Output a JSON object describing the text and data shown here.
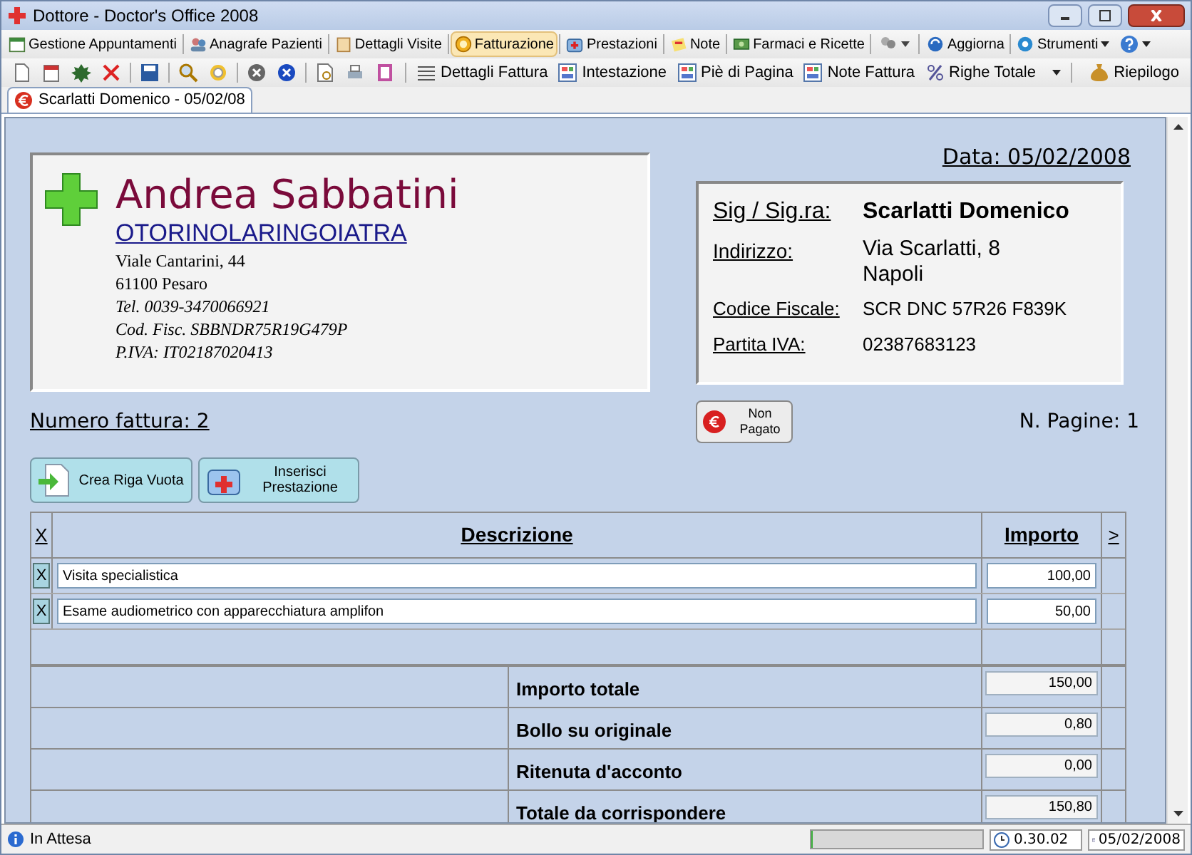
{
  "window": {
    "title": "Dottore - Doctor's Office 2008"
  },
  "main_toolbar": {
    "items": [
      {
        "label": "Gestione Appuntamenti",
        "selected": false,
        "dropdown": false
      },
      {
        "label": "Anagrafe Pazienti",
        "selected": false,
        "dropdown": false
      },
      {
        "label": "Dettagli Visite",
        "selected": false,
        "dropdown": false
      },
      {
        "label": "Fatturazione",
        "selected": true,
        "dropdown": false
      },
      {
        "label": "Prestazioni",
        "selected": false,
        "dropdown": false
      },
      {
        "label": "Note",
        "selected": false,
        "dropdown": false
      },
      {
        "label": "Farmaci e Ricette",
        "selected": false,
        "dropdown": false
      },
      {
        "label": "Aggiorna",
        "selected": false,
        "dropdown": false
      },
      {
        "label": "Strumenti",
        "selected": false,
        "dropdown": true
      }
    ]
  },
  "invoice_toolbar": {
    "items": [
      {
        "label": "Dettagli Fattura",
        "dropdown": false
      },
      {
        "label": "Intestazione",
        "dropdown": false
      },
      {
        "label": "Piè di Pagina",
        "dropdown": false
      },
      {
        "label": "Note Fattura",
        "dropdown": false
      },
      {
        "label": "Righe Totale",
        "dropdown": true
      }
    ],
    "summary_button": "Riepilogo"
  },
  "tabs": [
    {
      "label": "Scarlatti Domenico - 05/02/08",
      "selected": true
    }
  ],
  "invoice": {
    "date": "Data: 05/02/2008",
    "doctor": {
      "name": "Andrea Sabbatini",
      "specialty": "OTORINOLARINGOIATRA",
      "lines": [
        {
          "text": "Viale Cantarini, 44",
          "italic": false
        },
        {
          "text": "61100 Pesaro",
          "italic": false
        },
        {
          "text": "Tel. 0039-3470066921",
          "italic": true
        },
        {
          "text": "Cod. Fisc. SBBNDR75R19G479P",
          "italic": true
        },
        {
          "text": "P.IVA: IT02187020413",
          "italic": true
        }
      ]
    },
    "patient": [
      {
        "label": "Sig / Sig.ra:",
        "value": [
          "Scarlatti Domenico"
        ],
        "kind": "title"
      },
      {
        "label": "Indirizzo:",
        "value": [
          "Via Scarlatti, 8",
          "Napoli"
        ],
        "kind": "large"
      },
      {
        "label": "Codice Fiscale:",
        "value": [
          "SCR DNC 57R26 F839K"
        ],
        "kind": "small"
      },
      {
        "label": "Partita IVA:",
        "value": [
          "02387683123"
        ],
        "kind": "small"
      }
    ],
    "invoice_number": "Numero fattura: 2",
    "payment_button": {
      "label": "Non Pagato",
      "paid": false
    },
    "pages": "N. Pagine: 1",
    "buttons": [
      "Crea Riga Vuota",
      "Inserisci Prestazione"
    ],
    "table": {
      "columns": [
        "X",
        "Descrizione",
        "Importo",
        ">"
      ],
      "rows": [
        {
          "delete": "X",
          "description": "Visita specialistica",
          "amount": "100,00"
        },
        {
          "delete": "X",
          "description": "Esame audiometrico con apparecchiatura amplifon",
          "amount": "50,00"
        }
      ]
    },
    "totals": [
      {
        "label": "Importo totale",
        "value": "150,00"
      },
      {
        "label": "Bollo su originale",
        "value": "0,80"
      },
      {
        "label": "Ritenuta d'acconto",
        "value": "0,00"
      },
      {
        "label": "Totale da corrispondere",
        "value": "150,80"
      }
    ]
  },
  "status_bar": {
    "text": "In Attesa",
    "progress": {
      "level": 0.01
    },
    "time": "0.30.02",
    "date": "05/02/2008"
  }
}
